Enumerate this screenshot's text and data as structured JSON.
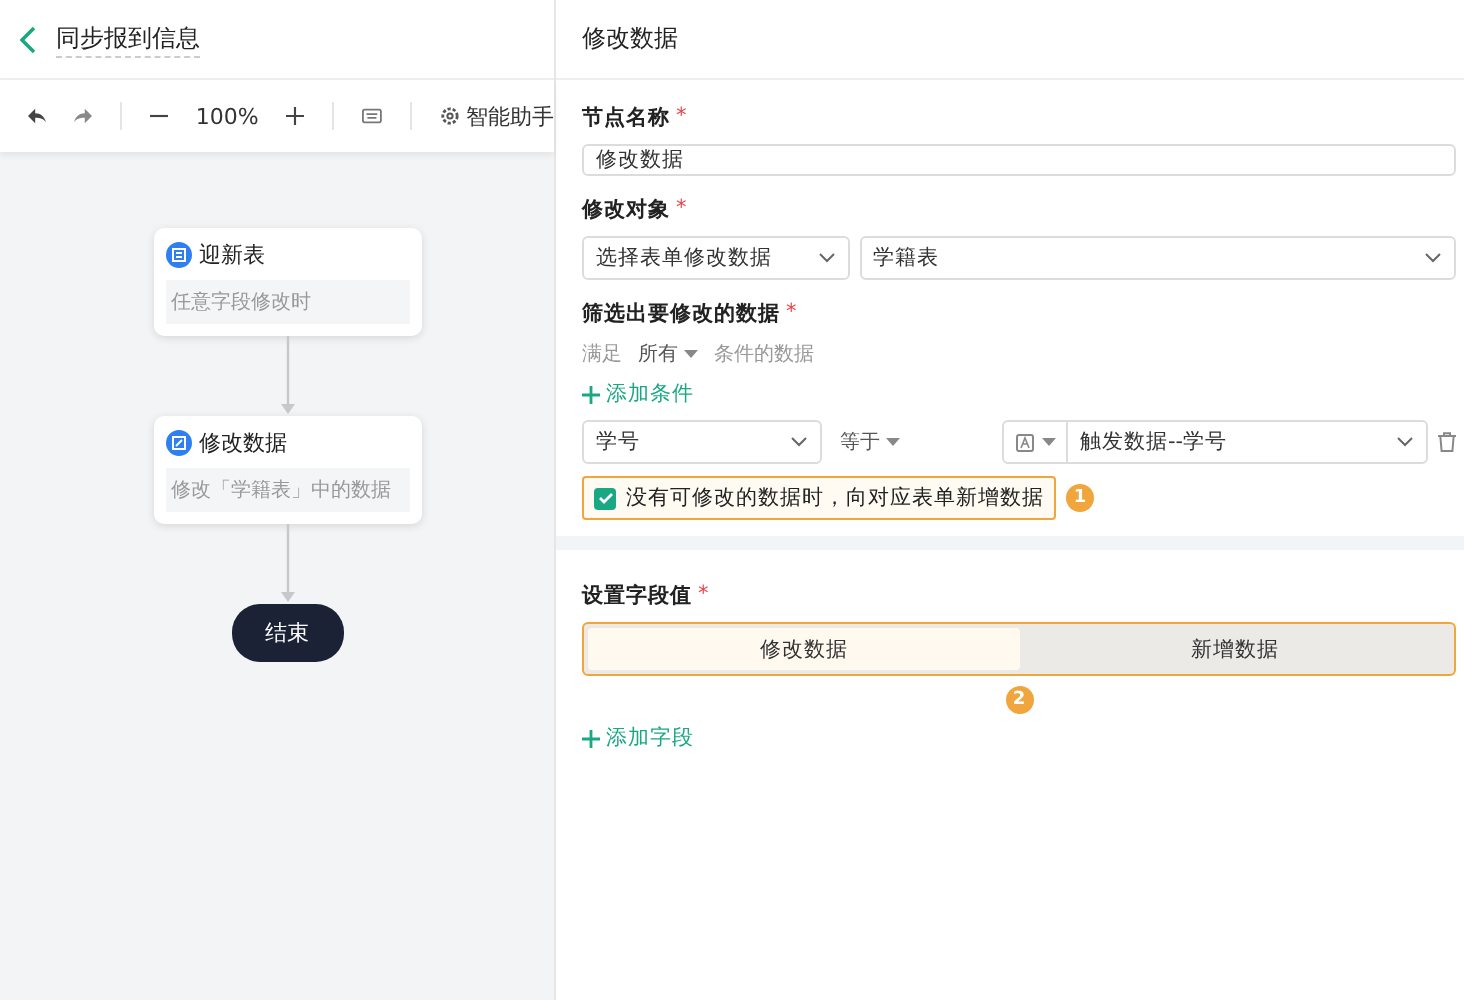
{
  "header": {
    "title": "同步报到信息"
  },
  "toolbar": {
    "zoom": "100%",
    "assistant": "智能助手"
  },
  "flow": {
    "nodes": [
      {
        "kind": "trigger",
        "title": "迎新表",
        "detail": "任意字段修改时"
      },
      {
        "kind": "update",
        "title": "修改数据",
        "detail": "修改「学籍表」中的数据"
      },
      {
        "kind": "end",
        "title": "结束"
      }
    ]
  },
  "panel": {
    "title": "修改数据",
    "node_name": {
      "label": "节点名称",
      "required_mark": "*",
      "value": "修改数据"
    },
    "target": {
      "label": "修改对象",
      "required_mark": "*",
      "mode": "选择表单修改数据",
      "form": "学籍表"
    },
    "filter": {
      "label": "筛选出要修改的数据",
      "required_mark": "*",
      "prefix": "满足",
      "match": "所有",
      "suffix": "条件的数据",
      "add": "添加条件",
      "condition": {
        "field": "学号",
        "operator": "等于",
        "value": "触发数据--学号"
      },
      "fallback": {
        "label": "没有可修改的数据时，向对应表单新增数据",
        "checked": true,
        "badge": "1"
      }
    },
    "fields": {
      "label": "设置字段值",
      "required_mark": "*",
      "tabs": [
        {
          "label": "修改数据",
          "selected": true
        },
        {
          "label": "新增数据",
          "selected": false
        }
      ],
      "badge": "2",
      "add": "添加字段"
    }
  }
}
